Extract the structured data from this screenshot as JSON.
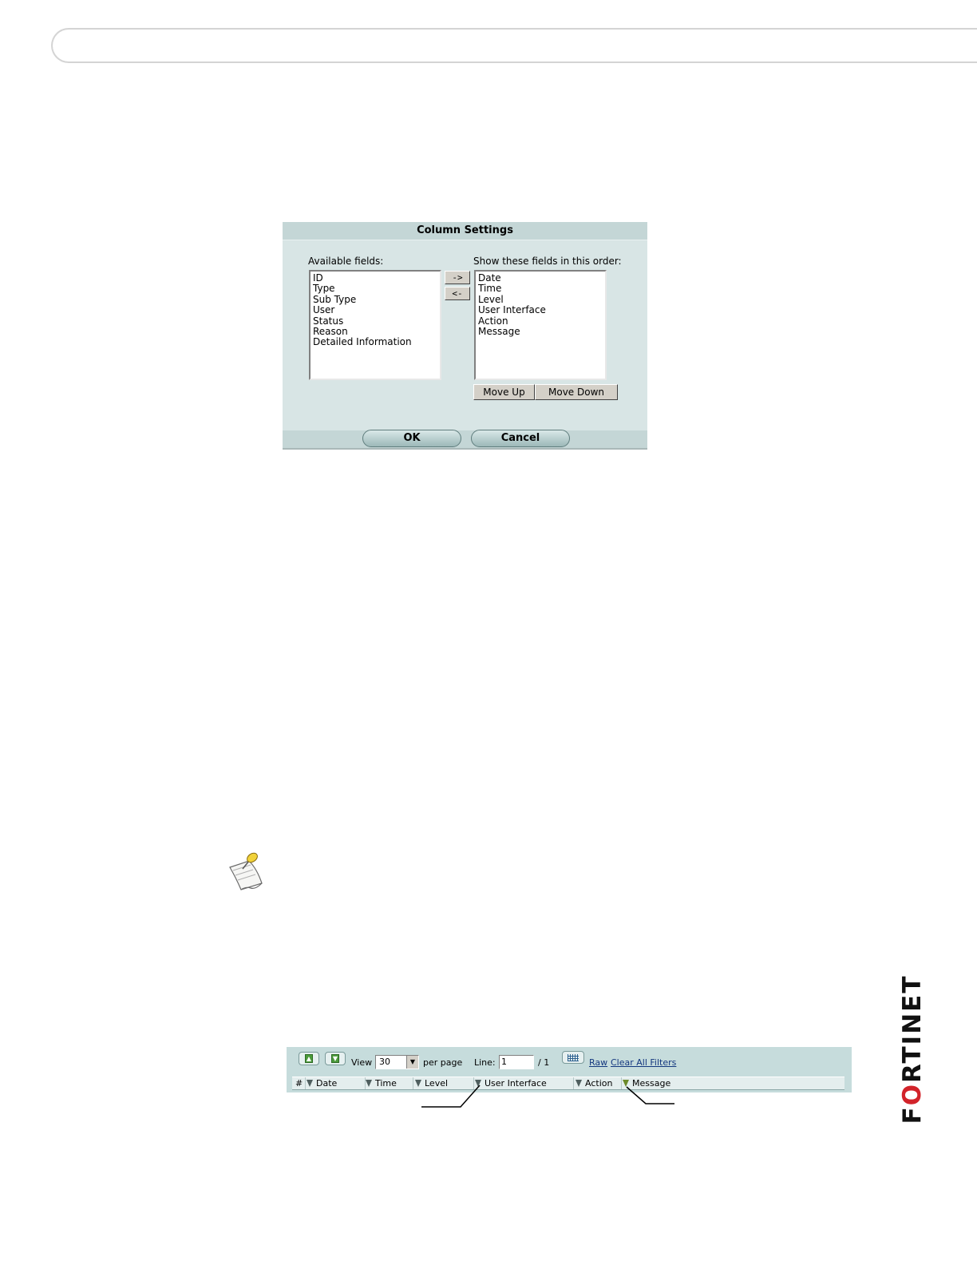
{
  "column_settings": {
    "title": "Column Settings",
    "available_label": "Available fields:",
    "available_fields": [
      "ID",
      "Type",
      "Sub Type",
      "User",
      "Status",
      "Reason",
      "Detailed Information"
    ],
    "shown_label": "Show these fields in this order:",
    "shown_fields": [
      "Date",
      "Time",
      "Level",
      "User Interface",
      "Action",
      "Message"
    ],
    "add_button": "->",
    "remove_button": "<-",
    "move_up": "Move Up",
    "move_down": "Move Down",
    "ok": "OK",
    "cancel": "Cancel"
  },
  "log_toolbar": {
    "view_label": "View",
    "per_page_value": "30",
    "per_page_label": "per page",
    "line_label": "Line:",
    "line_value": "1",
    "line_total": "/ 1",
    "raw_link": "Raw",
    "clear_filters_link": "Clear All Filters",
    "columns": [
      {
        "label": "#",
        "filter": false
      },
      {
        "label": "Date",
        "filter": true
      },
      {
        "label": "Time",
        "filter": true
      },
      {
        "label": "Level",
        "filter": true
      },
      {
        "label": "User Interface",
        "filter": true
      },
      {
        "label": "Action",
        "filter": true
      },
      {
        "label": "Message",
        "filter": true,
        "active": true
      }
    ]
  },
  "colors": {
    "dialog_bg": "#d8e5e5",
    "toolbar_bg": "#c6dcdc",
    "logo_accent": "#d2232a"
  },
  "icons": [
    "note-pushpin-icon",
    "page-up-icon",
    "page-down-icon",
    "column-settings-icon",
    "filter-icon"
  ],
  "logo": {
    "text_a": "F",
    "text_o": "O",
    "text_b": "RTINET"
  }
}
